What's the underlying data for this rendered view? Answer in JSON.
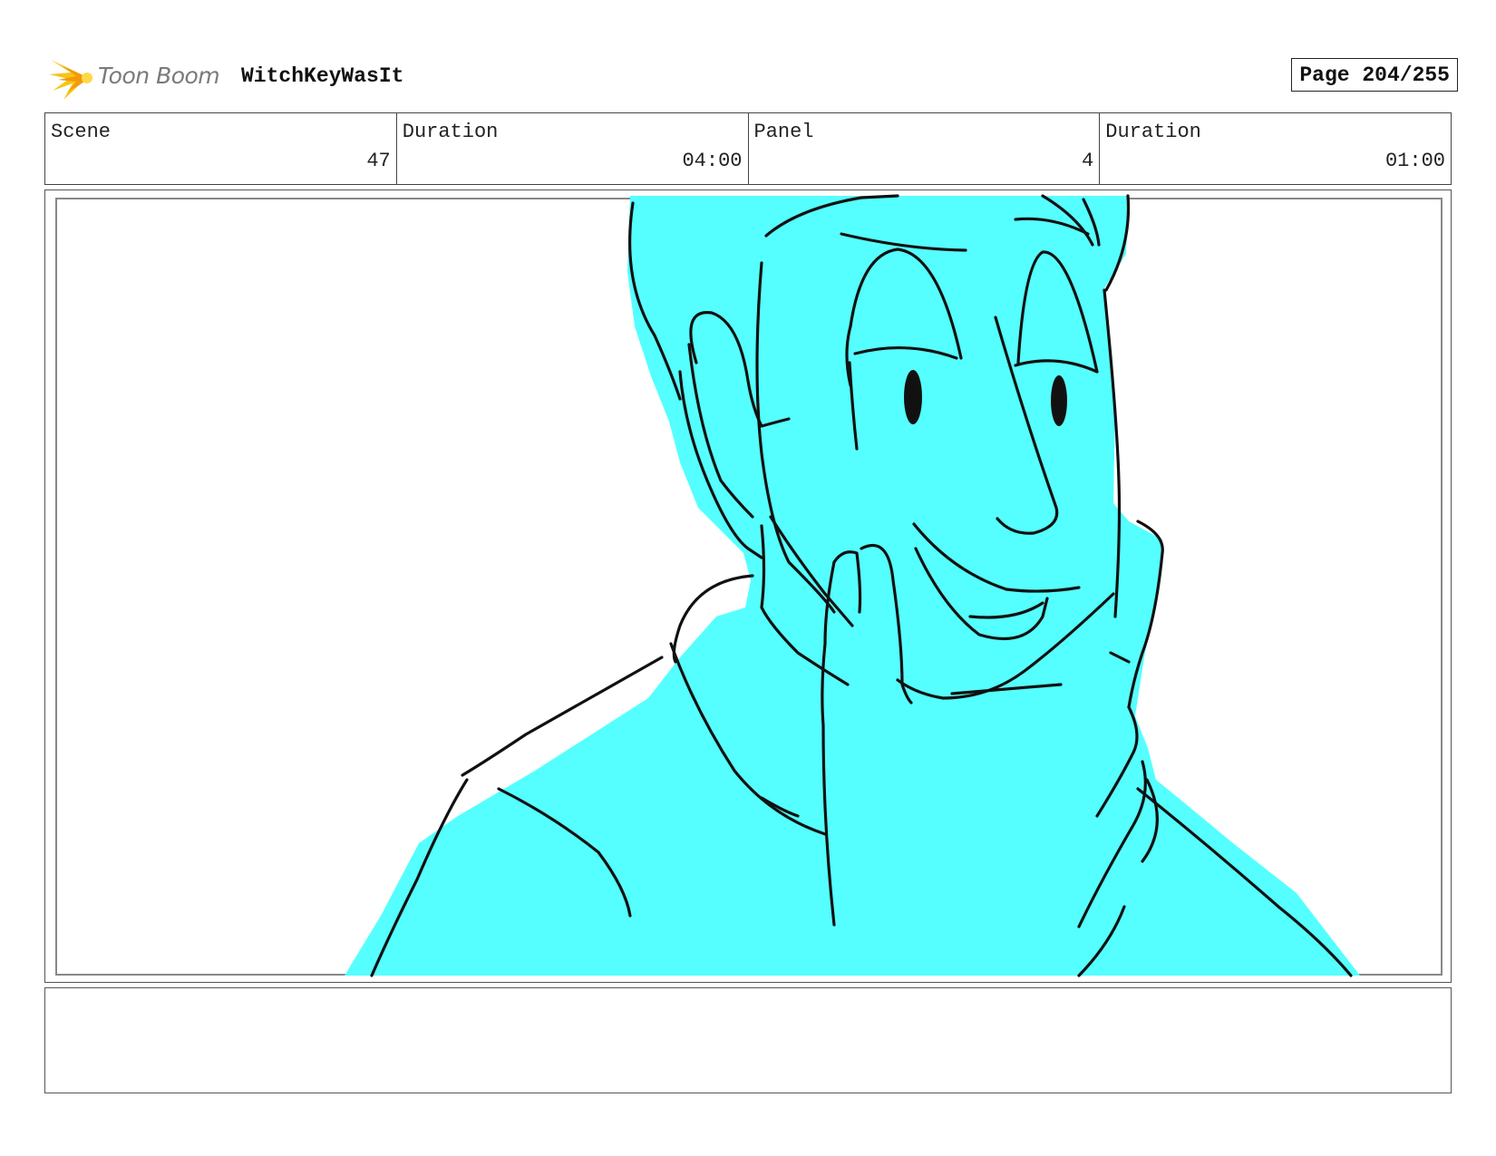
{
  "header": {
    "logo_text": "Toon Boom",
    "project_title": "WitchKeyWasIt",
    "page_label": "Page 204/255"
  },
  "info": {
    "scene_label": "Scene",
    "scene_value": "47",
    "scene_duration_label": "Duration",
    "scene_duration_value": "04:00",
    "panel_label": "Panel",
    "panel_value": "4",
    "panel_duration_label": "Duration",
    "panel_duration_value": "01:00"
  },
  "colors": {
    "fill": "#55ffff",
    "line": "#111111",
    "logo_accent": "#f5c518"
  },
  "notes": {
    "text": ""
  }
}
